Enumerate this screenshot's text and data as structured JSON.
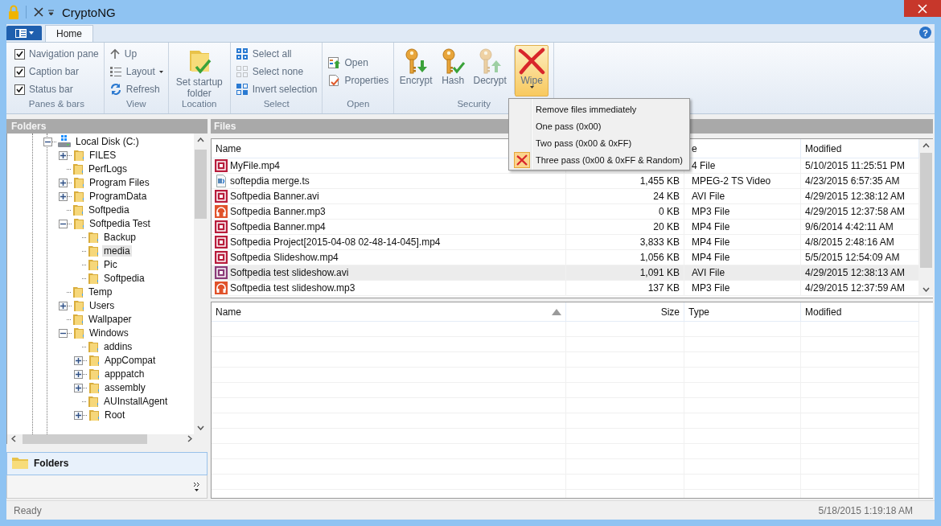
{
  "window": {
    "title": "CryptoNG"
  },
  "ribbon": {
    "help": "?",
    "tabs": [
      {
        "label": "Home",
        "selected": true
      }
    ],
    "groups": [
      {
        "label": "Panes & bars",
        "items": [
          {
            "kind": "checkbox",
            "label": "Navigation pane",
            "checked": true
          },
          {
            "kind": "checkbox",
            "label": "Caption bar",
            "checked": true
          },
          {
            "kind": "checkbox",
            "label": "Status bar",
            "checked": true
          }
        ]
      },
      {
        "label": "View",
        "items": [
          {
            "kind": "small",
            "label": "Up",
            "disabled": false
          },
          {
            "kind": "small-menu",
            "label": "Layout",
            "disabled": false
          },
          {
            "kind": "small",
            "label": "Refresh",
            "disabled": false
          }
        ]
      },
      {
        "label": "Location",
        "items": [
          {
            "kind": "large",
            "label": "Set startup folder",
            "disabled": false
          }
        ]
      },
      {
        "label": "Select",
        "items": [
          {
            "kind": "small",
            "label": "Select all",
            "disabled": false
          },
          {
            "kind": "small",
            "label": "Select none",
            "disabled": true
          },
          {
            "kind": "small",
            "label": "Invert selection",
            "disabled": false
          }
        ]
      },
      {
        "label": "Open",
        "items": [
          {
            "kind": "small",
            "label": "Open",
            "disabled": false
          },
          {
            "kind": "small",
            "label": "Properties",
            "disabled": false
          }
        ]
      },
      {
        "label": "Security",
        "items": [
          {
            "kind": "large",
            "label": "Encrypt",
            "disabled": false,
            "pressed": false
          },
          {
            "kind": "large",
            "label": "Hash",
            "disabled": false,
            "pressed": false
          },
          {
            "kind": "large",
            "label": "Decrypt",
            "disabled": true,
            "pressed": false
          },
          {
            "kind": "large-menu",
            "label": "Wipe",
            "disabled": false,
            "pressed": true
          }
        ]
      }
    ]
  },
  "wipe_menu": {
    "items": [
      {
        "label": "Remove files immediately",
        "checked": false
      },
      {
        "label": "One pass (0x00)",
        "checked": false
      },
      {
        "label": "Two pass (0x00 & 0xFF)",
        "checked": false
      },
      {
        "label": "Three pass (0x00 & 0xFF & Random)",
        "checked": true
      }
    ]
  },
  "folders": {
    "header": "Folders",
    "nav_button": "Folders",
    "tree": [
      {
        "label": "Local Disk (C:)",
        "kind": "drive",
        "expandable": true,
        "expanded": true,
        "selected": false,
        "children": [
          {
            "label": "FILES",
            "kind": "folder",
            "expandable": true,
            "expanded": false,
            "selected": false
          },
          {
            "label": "PerfLogs",
            "kind": "folder",
            "expandable": false,
            "selected": false
          },
          {
            "label": "Program Files",
            "kind": "folder",
            "expandable": true,
            "expanded": false,
            "selected": false
          },
          {
            "label": "ProgramData",
            "kind": "folder",
            "expandable": true,
            "expanded": false,
            "selected": false
          },
          {
            "label": "Softpedia",
            "kind": "folder",
            "expandable": false,
            "selected": false
          },
          {
            "label": "Softpedia Test",
            "kind": "folder",
            "expandable": true,
            "expanded": true,
            "selected": false,
            "children": [
              {
                "label": "Backup",
                "kind": "folder",
                "expandable": false,
                "selected": false
              },
              {
                "label": "media",
                "kind": "folder",
                "expandable": false,
                "selected": true
              },
              {
                "label": "Pic",
                "kind": "folder",
                "expandable": false,
                "selected": false
              },
              {
                "label": "Softpedia",
                "kind": "folder",
                "expandable": false,
                "selected": false
              }
            ]
          },
          {
            "label": "Temp",
            "kind": "folder",
            "expandable": false,
            "selected": false
          },
          {
            "label": "Users",
            "kind": "folder",
            "expandable": true,
            "expanded": false,
            "selected": false
          },
          {
            "label": "Wallpaper",
            "kind": "folder",
            "expandable": false,
            "selected": false
          },
          {
            "label": "Windows",
            "kind": "folder",
            "expandable": true,
            "expanded": true,
            "selected": false,
            "children": [
              {
                "label": "addins",
                "kind": "folder",
                "expandable": false,
                "selected": false
              },
              {
                "label": "AppCompat",
                "kind": "folder",
                "expandable": true,
                "expanded": false,
                "selected": false
              },
              {
                "label": "apppatch",
                "kind": "folder",
                "expandable": true,
                "expanded": false,
                "selected": false
              },
              {
                "label": "assembly",
                "kind": "folder",
                "expandable": true,
                "expanded": false,
                "selected": false
              },
              {
                "label": "AUInstallAgent",
                "kind": "folder",
                "expandable": false,
                "selected": false
              },
              {
                "label": "Root",
                "kind": "folder",
                "expandable": true,
                "expanded": false,
                "selected": false
              }
            ]
          }
        ]
      }
    ]
  },
  "files": {
    "header": "Files",
    "columns": [
      {
        "label": "Name"
      },
      {},
      {
        "label": "e"
      },
      {
        "label": "Modified"
      }
    ],
    "rows": [
      {
        "kind": "video",
        "name": "MyFile.mp4",
        "type": "4 File",
        "modified": "5/10/2015 11:25:51 PM",
        "selected": false
      },
      {
        "kind": "ts",
        "name": "softepdia merge.ts",
        "size": "1,455 KB",
        "type": "MPEG-2 TS Video",
        "modified": "4/23/2015 6:57:35 AM",
        "selected": false
      },
      {
        "kind": "video",
        "name": "Softpedia Banner.avi",
        "size": "24 KB",
        "type": "AVI File",
        "modified": "4/29/2015 12:38:12 AM",
        "selected": false
      },
      {
        "kind": "audio",
        "name": "Softpedia Banner.mp3",
        "size": "0 KB",
        "type": "MP3 File",
        "modified": "4/29/2015 12:37:58 AM",
        "selected": false
      },
      {
        "kind": "video",
        "name": "Softpedia Banner.mp4",
        "size": "20 KB",
        "type": "MP4 File",
        "modified": "9/6/2014 4:42:11 AM",
        "selected": false
      },
      {
        "kind": "video",
        "name": "Softpedia Project[2015-04-08 02-48-14-045].mp4",
        "size": "3,833 KB",
        "type": "MP4 File",
        "modified": "4/8/2015 2:48:16 AM",
        "selected": false
      },
      {
        "kind": "video",
        "name": "Softpedia Slideshow.mp4",
        "size": "1,056 KB",
        "type": "MP4 File",
        "modified": "5/5/2015 12:54:09 AM",
        "selected": false
      },
      {
        "kind": "video",
        "name": "Softpedia test slideshow.avi",
        "size": "1,091 KB",
        "type": "AVI File",
        "modified": "4/29/2015 12:38:13 AM",
        "selected": true
      },
      {
        "kind": "audio",
        "name": "Softpedia test slideshow.mp3",
        "size": "137 KB",
        "type": "MP3 File",
        "modified": "4/29/2015 12:37:59 AM",
        "selected": false
      }
    ]
  },
  "queue": {
    "columns": [
      {
        "label": "Name",
        "sorted": true
      },
      {
        "label": "Size",
        "sorted": false
      },
      {
        "label": "Type",
        "sorted": false
      },
      {
        "label": "Modified",
        "sorted": false
      }
    ]
  },
  "status_bar": {
    "text": "Ready",
    "time": "5/18/2015 1:19:18 AM"
  }
}
